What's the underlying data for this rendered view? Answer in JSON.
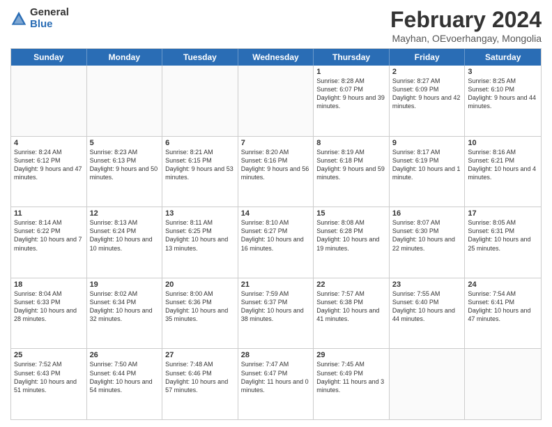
{
  "logo": {
    "general": "General",
    "blue": "Blue"
  },
  "title": "February 2024",
  "subtitle": "Mayhan, OEvoerhangay, Mongolia",
  "header_days": [
    "Sunday",
    "Monday",
    "Tuesday",
    "Wednesday",
    "Thursday",
    "Friday",
    "Saturday"
  ],
  "weeks": [
    [
      {
        "day": "",
        "info": ""
      },
      {
        "day": "",
        "info": ""
      },
      {
        "day": "",
        "info": ""
      },
      {
        "day": "",
        "info": ""
      },
      {
        "day": "1",
        "info": "Sunrise: 8:28 AM\nSunset: 6:07 PM\nDaylight: 9 hours\nand 39 minutes."
      },
      {
        "day": "2",
        "info": "Sunrise: 8:27 AM\nSunset: 6:09 PM\nDaylight: 9 hours\nand 42 minutes."
      },
      {
        "day": "3",
        "info": "Sunrise: 8:25 AM\nSunset: 6:10 PM\nDaylight: 9 hours\nand 44 minutes."
      }
    ],
    [
      {
        "day": "4",
        "info": "Sunrise: 8:24 AM\nSunset: 6:12 PM\nDaylight: 9 hours\nand 47 minutes."
      },
      {
        "day": "5",
        "info": "Sunrise: 8:23 AM\nSunset: 6:13 PM\nDaylight: 9 hours\nand 50 minutes."
      },
      {
        "day": "6",
        "info": "Sunrise: 8:21 AM\nSunset: 6:15 PM\nDaylight: 9 hours\nand 53 minutes."
      },
      {
        "day": "7",
        "info": "Sunrise: 8:20 AM\nSunset: 6:16 PM\nDaylight: 9 hours\nand 56 minutes."
      },
      {
        "day": "8",
        "info": "Sunrise: 8:19 AM\nSunset: 6:18 PM\nDaylight: 9 hours\nand 59 minutes."
      },
      {
        "day": "9",
        "info": "Sunrise: 8:17 AM\nSunset: 6:19 PM\nDaylight: 10 hours\nand 1 minute."
      },
      {
        "day": "10",
        "info": "Sunrise: 8:16 AM\nSunset: 6:21 PM\nDaylight: 10 hours\nand 4 minutes."
      }
    ],
    [
      {
        "day": "11",
        "info": "Sunrise: 8:14 AM\nSunset: 6:22 PM\nDaylight: 10 hours\nand 7 minutes."
      },
      {
        "day": "12",
        "info": "Sunrise: 8:13 AM\nSunset: 6:24 PM\nDaylight: 10 hours\nand 10 minutes."
      },
      {
        "day": "13",
        "info": "Sunrise: 8:11 AM\nSunset: 6:25 PM\nDaylight: 10 hours\nand 13 minutes."
      },
      {
        "day": "14",
        "info": "Sunrise: 8:10 AM\nSunset: 6:27 PM\nDaylight: 10 hours\nand 16 minutes."
      },
      {
        "day": "15",
        "info": "Sunrise: 8:08 AM\nSunset: 6:28 PM\nDaylight: 10 hours\nand 19 minutes."
      },
      {
        "day": "16",
        "info": "Sunrise: 8:07 AM\nSunset: 6:30 PM\nDaylight: 10 hours\nand 22 minutes."
      },
      {
        "day": "17",
        "info": "Sunrise: 8:05 AM\nSunset: 6:31 PM\nDaylight: 10 hours\nand 25 minutes."
      }
    ],
    [
      {
        "day": "18",
        "info": "Sunrise: 8:04 AM\nSunset: 6:33 PM\nDaylight: 10 hours\nand 28 minutes."
      },
      {
        "day": "19",
        "info": "Sunrise: 8:02 AM\nSunset: 6:34 PM\nDaylight: 10 hours\nand 32 minutes."
      },
      {
        "day": "20",
        "info": "Sunrise: 8:00 AM\nSunset: 6:36 PM\nDaylight: 10 hours\nand 35 minutes."
      },
      {
        "day": "21",
        "info": "Sunrise: 7:59 AM\nSunset: 6:37 PM\nDaylight: 10 hours\nand 38 minutes."
      },
      {
        "day": "22",
        "info": "Sunrise: 7:57 AM\nSunset: 6:38 PM\nDaylight: 10 hours\nand 41 minutes."
      },
      {
        "day": "23",
        "info": "Sunrise: 7:55 AM\nSunset: 6:40 PM\nDaylight: 10 hours\nand 44 minutes."
      },
      {
        "day": "24",
        "info": "Sunrise: 7:54 AM\nSunset: 6:41 PM\nDaylight: 10 hours\nand 47 minutes."
      }
    ],
    [
      {
        "day": "25",
        "info": "Sunrise: 7:52 AM\nSunset: 6:43 PM\nDaylight: 10 hours\nand 51 minutes."
      },
      {
        "day": "26",
        "info": "Sunrise: 7:50 AM\nSunset: 6:44 PM\nDaylight: 10 hours\nand 54 minutes."
      },
      {
        "day": "27",
        "info": "Sunrise: 7:48 AM\nSunset: 6:46 PM\nDaylight: 10 hours\nand 57 minutes."
      },
      {
        "day": "28",
        "info": "Sunrise: 7:47 AM\nSunset: 6:47 PM\nDaylight: 11 hours\nand 0 minutes."
      },
      {
        "day": "29",
        "info": "Sunrise: 7:45 AM\nSunset: 6:49 PM\nDaylight: 11 hours\nand 3 minutes."
      },
      {
        "day": "",
        "info": ""
      },
      {
        "day": "",
        "info": ""
      }
    ]
  ]
}
